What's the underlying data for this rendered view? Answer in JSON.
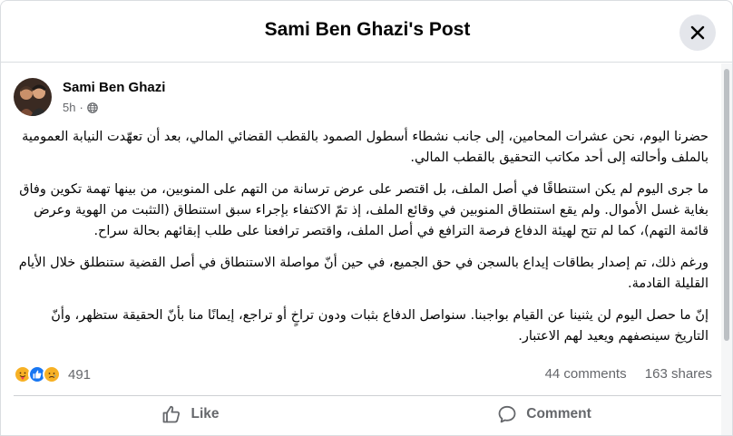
{
  "dialog": {
    "title": "Sami Ben Ghazi's Post",
    "close_icon": "close-icon"
  },
  "post": {
    "author": "Sami Ben Ghazi",
    "time": "5h",
    "privacy_icon": "globe-icon",
    "paragraphs": [
      "حضرنا اليوم، نحن عشرات المحامين، إلى جانب نشطاء أسطول الصمود بالقطب القضائي المالي، بعد أن تعهّدت النيابة العمومية بالملف وأحالته إلى أحد مكاتب التحقيق بالقطب المالي.",
      "ما جرى اليوم لم يكن استنطاقًا في أصل الملف، بل اقتصر على عرض ترسانة من التهم على المنوبين، من بينها تهمة تكوين وفاق بغاية غسل الأموال. ولم يقع استنطاق المنوبين في وقائع الملف، إذ تمّ الاكتفاء بإجراء سبق استنطاق (التثبت من الهوية وعرض قائمة التهم)، كما لم تتح لهيئة الدفاع فرصة الترافع في أصل الملف، واقتصر ترافعنا على طلب إبقائهم بحالة سراح.",
      "ورغم ذلك، تم إصدار بطاقات إيداع بالسجن في حق الجميع، في حين أنّ مواصلة الاستنطاق في أصل القضية ستنطلق خلال الأيام القليلة القادمة.",
      "إنّ ما حصل اليوم لن يثنينا عن القيام بواجبنا. سنواصل الدفاع بثبات ودون تراخٍ أو تراجع، إيمانًا منا بأنّ الحقيقة ستظهر، وأنّ التاريخ سينصفهم ويعيد لهم الاعتبار."
    ]
  },
  "stats": {
    "reaction_icons": [
      "care-reaction-icon",
      "like-reaction-icon",
      "sad-reaction-icon"
    ],
    "reaction_count": "491",
    "comments": "44 comments",
    "shares": "163 shares"
  },
  "actions": {
    "like_label": "Like",
    "comment_label": "Comment"
  },
  "colors": {
    "like_blue": "#1877f2",
    "reaction_yellow": "#f7b125",
    "muted_text": "#65676b"
  }
}
